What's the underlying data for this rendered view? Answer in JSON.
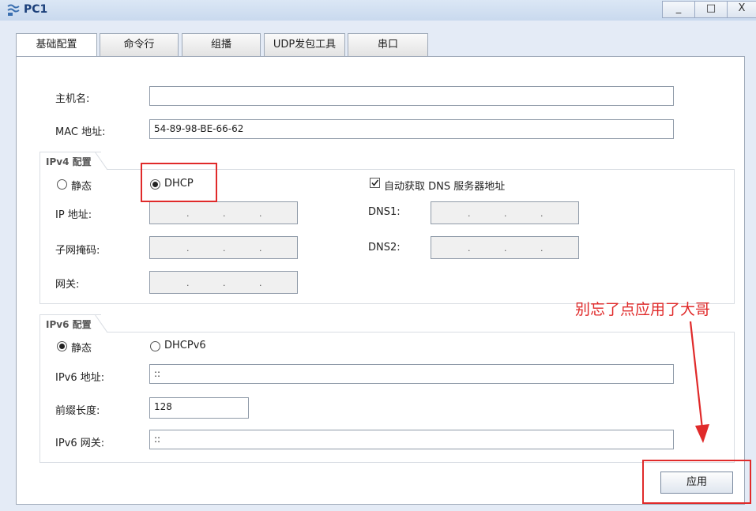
{
  "window": {
    "title": "PC1",
    "minimize": "_",
    "maximize": "□",
    "close": "X"
  },
  "tabs": [
    "基础配置",
    "命令行",
    "组播",
    "UDP发包工具",
    "串口"
  ],
  "basic": {
    "hostname_label": "主机名:",
    "hostname_value": "",
    "mac_label": "MAC 地址:",
    "mac_value": "54-89-98-BE-66-62"
  },
  "ipv4": {
    "group_title": "IPv4 配置",
    "static_label": "静态",
    "dhcp_label": "DHCP",
    "selected": "DHCP",
    "auto_dns_label": "自动获取 DNS 服务器地址",
    "auto_dns_checked": true,
    "ip_label": "IP 地址:",
    "mask_label": "子网掩码:",
    "gateway_label": "网关:",
    "dns1_label": "DNS1:",
    "dns2_label": "DNS2:",
    "ip_separator": "."
  },
  "ipv6": {
    "group_title": "IPv6 配置",
    "static_label": "静态",
    "dhcpv6_label": "DHCPv6",
    "selected": "静态",
    "address_label": "IPv6 地址:",
    "address_value": "::",
    "prefix_label": "前缀长度:",
    "prefix_value": "128",
    "gateway_label": "IPv6 网关:",
    "gateway_value": "::"
  },
  "annotation": {
    "text": "别忘了点应用了大哥",
    "color": "#e02a2a"
  },
  "apply_label": "应用"
}
